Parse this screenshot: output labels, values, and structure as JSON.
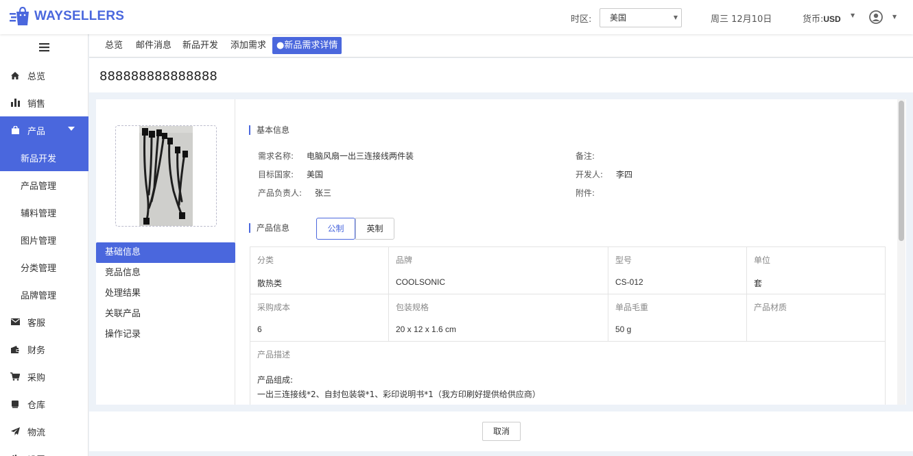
{
  "brand": {
    "name": "WAYSELLERS",
    "color": "#4a67dd"
  },
  "header": {
    "timezone_label": "时区:",
    "timezone_value": "美国",
    "date": "周三 12月10日",
    "currency_label": "货币:",
    "currency_value": "USD"
  },
  "sidebar": {
    "items": [
      {
        "label": "总览",
        "icon": "home-icon"
      },
      {
        "label": "销售",
        "icon": "bar-chart-icon"
      },
      {
        "label": "产品",
        "icon": "shopping-bag-icon"
      },
      {
        "label": "新品开发"
      },
      {
        "label": "产品管理"
      },
      {
        "label": "辅料管理"
      },
      {
        "label": "图片管理"
      },
      {
        "label": "分类管理"
      },
      {
        "label": "品牌管理"
      },
      {
        "label": "客服",
        "icon": "mail-icon"
      },
      {
        "label": "财务",
        "icon": "wallet-icon"
      },
      {
        "label": "采购",
        "icon": "cart-icon"
      },
      {
        "label": "仓库",
        "icon": "box-icon"
      },
      {
        "label": "物流",
        "icon": "paper-plane-icon"
      },
      {
        "label": "设置",
        "icon": "gear-icon"
      }
    ]
  },
  "tabs": [
    "总览",
    "邮件消息",
    "新品开发",
    "添加需求",
    "●新品需求详情"
  ],
  "page_title": "888888888888888",
  "detail_menu": [
    "基础信息",
    "竞品信息",
    "处理结果",
    "关联产品",
    "操作记录"
  ],
  "basic_info": {
    "section_title": "基本信息",
    "name_label": "需求名称:",
    "name_value": "电脑风扇一出三连接线两件装",
    "remark_label": "备注:",
    "country_label": "目标国家:",
    "country_value": "美国",
    "developer_label": "开发人:",
    "developer_value": "李四",
    "owner_label": "产品负责人:",
    "owner_value": "张三",
    "attachment_label": "附件:"
  },
  "product_info": {
    "section_title": "产品信息",
    "unit_metric": "公制",
    "unit_imperial": "英制",
    "row1": [
      {
        "h": "分类",
        "v": "散热类"
      },
      {
        "h": "品牌",
        "v": "COOLSONIC"
      },
      {
        "h": "型号",
        "v": "CS-012"
      },
      {
        "h": "单位",
        "v": "套"
      }
    ],
    "row2": [
      {
        "h": "采购成本",
        "v": "6"
      },
      {
        "h": "包装规格",
        "v": "20 x 12 x 1.6 cm"
      },
      {
        "h": "单品毛重",
        "v": "50 g"
      },
      {
        "h": "产品材质",
        "v": ""
      }
    ],
    "description_label": "产品描述",
    "description_line1": "产品组成:",
    "description_line2": "一出三连接线*2、自封包装袋*1、彩印说明书*1（我方印刷好提供给供应商）"
  },
  "footer": {
    "cancel_label": "取消"
  }
}
